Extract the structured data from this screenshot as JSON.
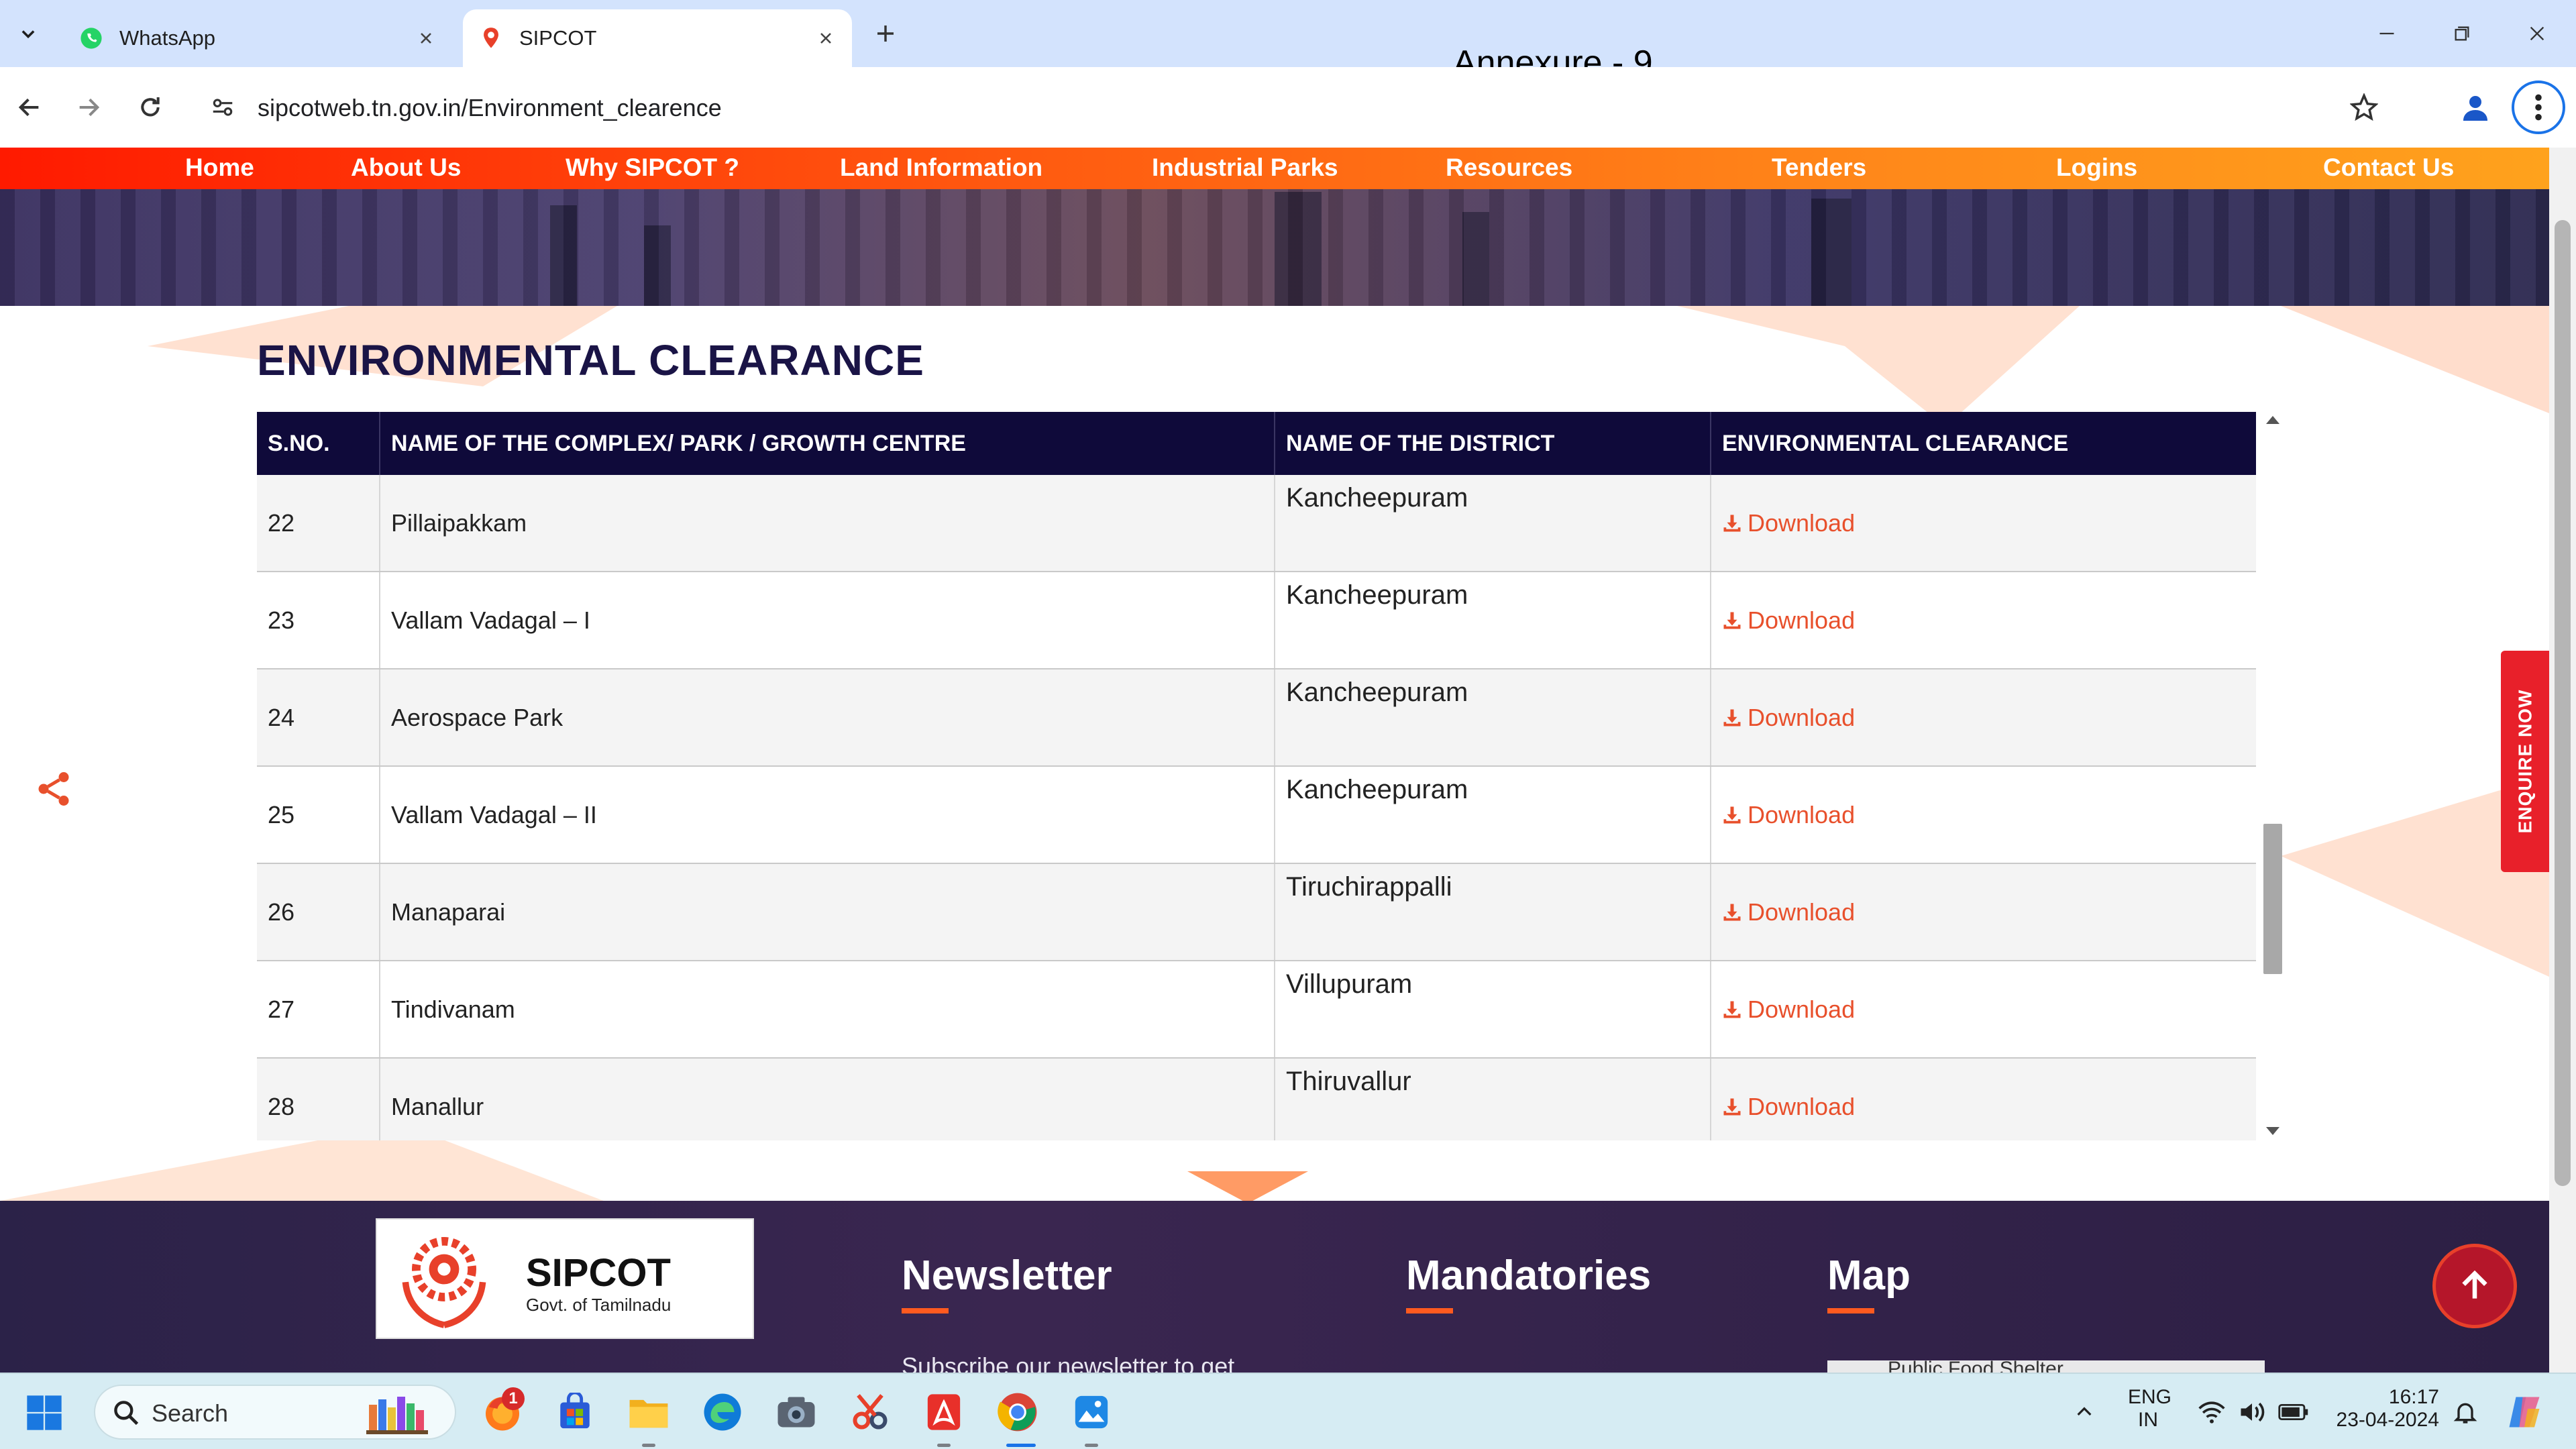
{
  "browser": {
    "tabs": [
      {
        "title": "WhatsApp",
        "active": false
      },
      {
        "title": "SIPCOT",
        "active": true
      }
    ],
    "url": "sipcotweb.tn.gov.in/Environment_clearence",
    "overlay_label": "Annexure - 9"
  },
  "site": {
    "nav": [
      "Home",
      "About Us",
      "Why SIPCOT ?",
      "Land Information",
      "Industrial Parks",
      "Resources",
      "Tenders",
      "Logins",
      "Contact Us"
    ],
    "nav_gradient": [
      "#ff1a00",
      "#ffa21c"
    ],
    "section_title": "ENVIRONMENTAL CLEARANCE",
    "table": {
      "headers": [
        "S.NO.",
        "NAME OF THE COMPLEX/ PARK / GROWTH CENTRE",
        "NAME OF THE DISTRICT",
        "ENVIRONMENTAL CLEARANCE"
      ],
      "rows": [
        {
          "sno": "22",
          "name": "Pillaipakkam",
          "district": "Kancheepuram",
          "link": "Download"
        },
        {
          "sno": "23",
          "name": "Vallam Vadagal – I",
          "district": "Kancheepuram",
          "link": "Download"
        },
        {
          "sno": "24",
          "name": "Aerospace Park",
          "district": "Kancheepuram",
          "link": "Download"
        },
        {
          "sno": "25",
          "name": "Vallam Vadagal – II",
          "district": "Kancheepuram",
          "link": "Download"
        },
        {
          "sno": "26",
          "name": "Manaparai",
          "district": "Tiruchirappalli",
          "link": "Download"
        },
        {
          "sno": "27",
          "name": "Tindivanam",
          "district": "Villupuram",
          "link": "Download"
        },
        {
          "sno": "28",
          "name": "Manallur",
          "district": "Thiruvallur",
          "link": "Download"
        }
      ],
      "header_bg": "#0f0a3a",
      "link_color": "#e8502c"
    },
    "enquire_label": "ENQUIRE NOW",
    "footer": {
      "logo_brand": "SIPCOT",
      "logo_sub": "Govt. of Tamilnadu",
      "headings": [
        "Newsletter",
        "Mandatories",
        "Map"
      ],
      "newsletter_partial": "Subscribe our newsletter to get",
      "map_partial": "Public Food Shelter"
    }
  },
  "taskbar": {
    "search_placeholder": "Search",
    "lang_top": "ENG",
    "lang_bottom": "IN",
    "time": "16:17",
    "date": "23-04-2024",
    "firefox_badge": "1"
  }
}
